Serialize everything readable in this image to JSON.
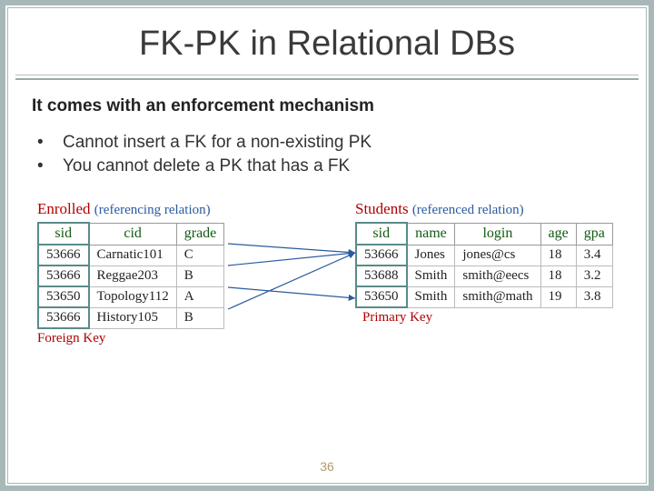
{
  "title": "FK-PK in Relational DBs",
  "lead": "It comes with an enforcement mechanism",
  "bullets": [
    "Cannot insert a FK for a non-existing PK",
    "You cannot delete a PK that has a FK"
  ],
  "enrolled": {
    "name": "Enrolled",
    "paren": "(referencing relation)",
    "sub": "Foreign Key",
    "headers": [
      "sid",
      "cid",
      "grade"
    ],
    "rows": [
      [
        "53666",
        "Carnatic101",
        "C"
      ],
      [
        "53666",
        "Reggae203",
        "B"
      ],
      [
        "53650",
        "Topology112",
        "A"
      ],
      [
        "53666",
        "History105",
        "B"
      ]
    ]
  },
  "students": {
    "name": "Students",
    "paren": "(referenced relation)",
    "sub": "Primary Key",
    "headers": [
      "sid",
      "name",
      "login",
      "age",
      "gpa"
    ],
    "rows": [
      [
        "53666",
        "Jones",
        "jones@cs",
        "18",
        "3.4"
      ],
      [
        "53688",
        "Smith",
        "smith@eecs",
        "18",
        "3.2"
      ],
      [
        "53650",
        "Smith",
        "smith@math",
        "19",
        "3.8"
      ]
    ]
  },
  "page_number": "36"
}
